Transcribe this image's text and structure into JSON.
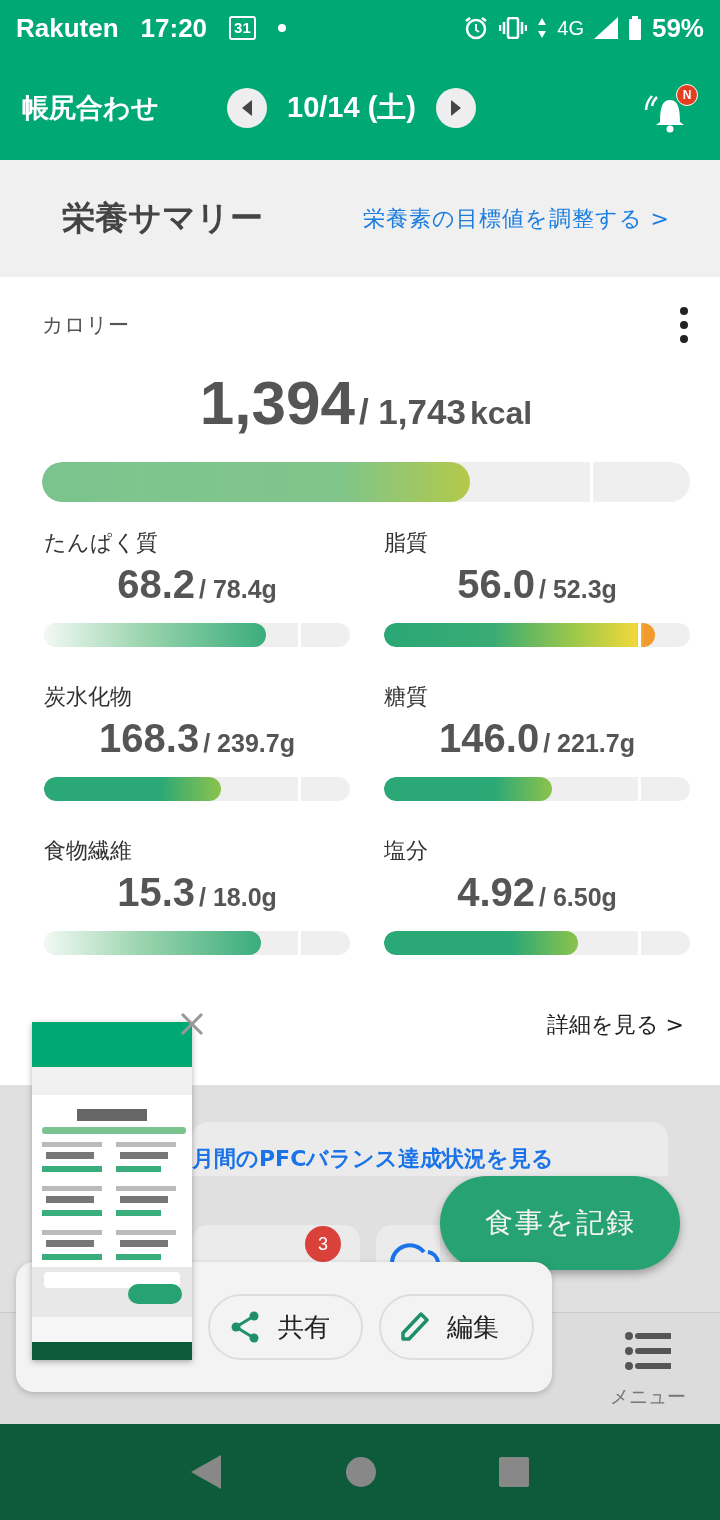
{
  "status_bar": {
    "carrier": "Rakuten",
    "time": "17:20",
    "calendar_day": "31",
    "network": "4G",
    "battery": "59%"
  },
  "app_bar": {
    "title": "帳尻合わせ",
    "date": "10/14 (土)",
    "notification_badge": "N"
  },
  "summary_header": {
    "title": "栄養サマリー",
    "link": "栄養素の目標値を調整する >"
  },
  "calorie": {
    "label": "カロリー",
    "value": "1,394",
    "target": "/ 1,743",
    "unit": "kcal",
    "level": 0.66,
    "kind": "soft"
  },
  "nutrients": [
    {
      "label": "たんぱく質",
      "value": "68.2",
      "target": "/ 78.4g",
      "level": 0.725,
      "kind": "fade"
    },
    {
      "label": "脂質",
      "value": "56.0",
      "target": "/ 52.3g",
      "level": 0.886,
      "kind": "over"
    },
    {
      "label": "炭水化物",
      "value": "168.3",
      "target": "/ 239.7g",
      "level": 0.58,
      "kind": "solid"
    },
    {
      "label": "糖質",
      "value": "146.0",
      "target": "/ 221.7g",
      "level": 0.55,
      "kind": "solid"
    },
    {
      "label": "食物繊維",
      "value": "15.3",
      "target": "/ 18.0g",
      "level": 0.71,
      "kind": "fade"
    },
    {
      "label": "塩分",
      "value": "4.92",
      "target": "/ 6.50g",
      "level": 0.635,
      "kind": "solid"
    }
  ],
  "details_link": "詳細を見る >",
  "pfc_link": "月間のPFCバランス達成状況を見る",
  "analysis_card": {
    "badge": "3"
  },
  "record_button": "食事を記録",
  "bottom_nav": [
    {
      "label": "メニュー",
      "selected": false
    }
  ],
  "share_sheet": {
    "share": "共有",
    "edit": "編集"
  }
}
